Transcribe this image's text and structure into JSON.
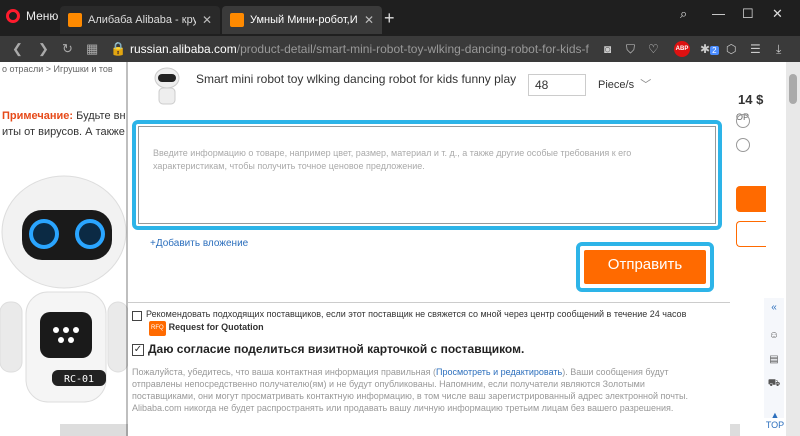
{
  "browser": {
    "menu_label": "Меню",
    "tabs": [
      {
        "title": "Алибаба Alibaba - крупнейш",
        "active": false
      },
      {
        "title": "Умный Мини-робот,Игруш",
        "active": true
      }
    ],
    "url_host": "russian.alibaba.com",
    "url_path": "/product-detail/smart-mini-robot-toy-wlking-dancing-robot-for-kids-f",
    "abp_label": "ABP",
    "ext_badge": "2",
    "accent_color": "#ff1b2d"
  },
  "background_page": {
    "breadcrumb": "о отрасли  >  Игрушки и тов",
    "note_label": "Примечание:",
    "note_text_1": "Будьте вн",
    "note_text_2": "иты от вирусов. А также",
    "price": "14 $",
    "op": "OP",
    "robot_label": "RC-01",
    "top_label": "TOP"
  },
  "modal": {
    "product_name": "Smart mini robot toy wlking dancing robot for kids funny play",
    "quantity": "48",
    "unit": "Piece/s",
    "textarea_placeholder": "Введите информацию о товаре, например цвет, размер, материал и т. д., а также другие особые требования к его характеристикам, чтобы получить точное ценовое предложение.",
    "attach_label": "Добавить вложение",
    "send_label": "Отправить",
    "recommend_text": "Рекомендовать подходящих поставщиков, если этот поставщик не свяжется со мной через центр сообщений в течение 24 часов",
    "rfq_badge": "RFQ",
    "rfq_label": "Request for Quotation",
    "consent_text": "Даю согласие поделиться визитной карточкой с поставщиком.",
    "disclaimer_1": "Пожалуйста, убедитесь, что ваша контактная информация правильная (",
    "disclaimer_link": "Просмотреть и редактировать",
    "disclaimer_2": "). Ваши сообщения будут отправлены непосредственно получателю(ям) и не будут опубликованы. Напомним, если получатели являются Золотыми поставщиками, они могут просматривать контактную информацию, в том числе ваш зарегистрированный адрес электронной почты. Alibaba.com никогда не будет распространять или продавать вашу личную информацию третьим лицам без вашего разрешения.",
    "highlight_color": "#2db4e8",
    "button_color": "#ff6a00"
  }
}
